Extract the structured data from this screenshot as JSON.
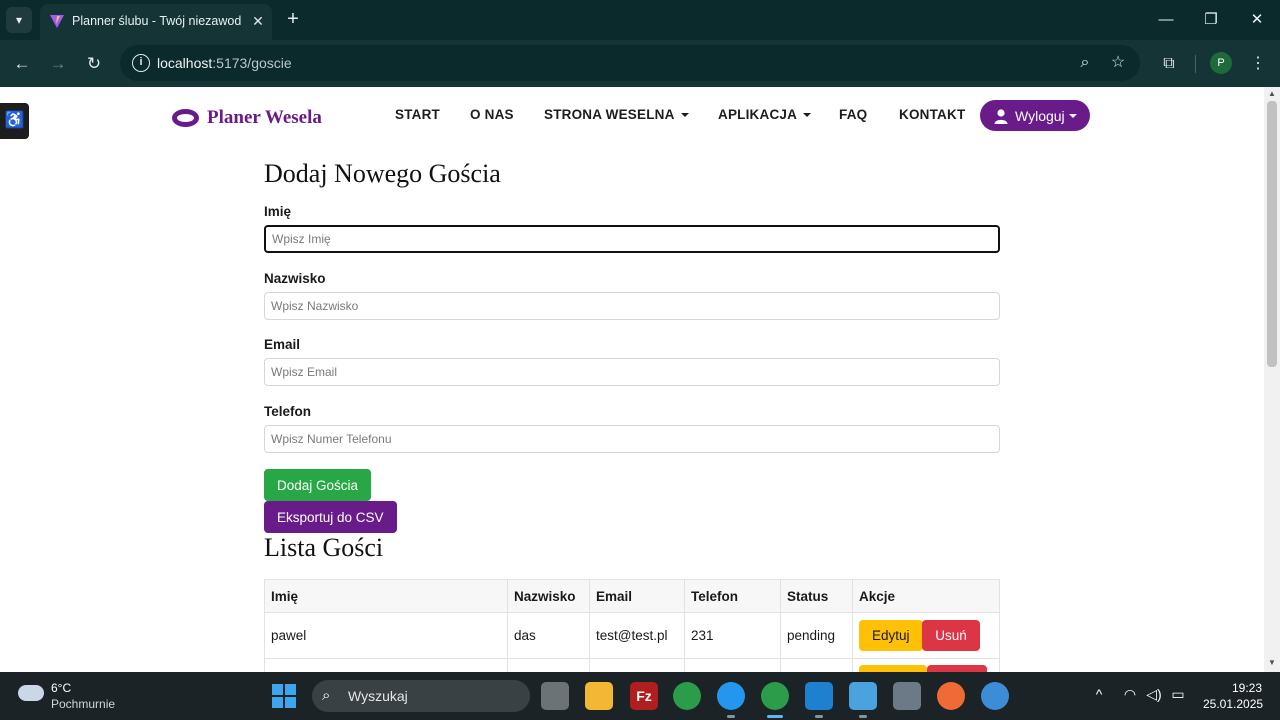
{
  "browser": {
    "tab_title": "Planner ślubu - Twój niezawodny",
    "url_host": "localhost",
    "url_path": ":5173/goscie",
    "profile_initial": "P"
  },
  "site": {
    "brand": "Planer Wesela",
    "nav": {
      "start": "START",
      "about": "O NAS",
      "wedding_page": "STRONA WESELNA",
      "app": "APLIKACJA",
      "faq": "FAQ",
      "contact": "KONTAKT"
    },
    "logout_label": "Wyloguj"
  },
  "form": {
    "title": "Dodaj Nowego Gościa",
    "first_name_label": "Imię",
    "first_name_placeholder": "Wpisz Imię",
    "last_name_label": "Nazwisko",
    "last_name_placeholder": "Wpisz Nazwisko",
    "email_label": "Email",
    "email_placeholder": "Wpisz Email",
    "phone_label": "Telefon",
    "phone_placeholder": "Wpisz Numer Telefonu",
    "add_button": "Dodaj Gościa",
    "export_button": "Eksportuj do CSV"
  },
  "guest_list": {
    "title": "Lista Gości",
    "columns": [
      "Imię",
      "Nazwisko",
      "Email",
      "Telefon",
      "Status",
      "Akcje"
    ],
    "rows": [
      {
        "first_name": "pawel",
        "last_name": "das",
        "email": "test@test.pl",
        "phone": "231",
        "status": "pending",
        "edit_label": "Edytuj",
        "delete_label": "Usuń"
      },
      {
        "first_name": "",
        "last_name": "",
        "email": "",
        "phone": "",
        "status": "",
        "edit_label": "",
        "delete_label": ""
      }
    ]
  },
  "taskbar": {
    "weather_temp": "6°C",
    "weather_desc": "Pochmurnie",
    "search_placeholder": "Wyszukaj",
    "time": "19:23",
    "date": "25.01.2025"
  }
}
